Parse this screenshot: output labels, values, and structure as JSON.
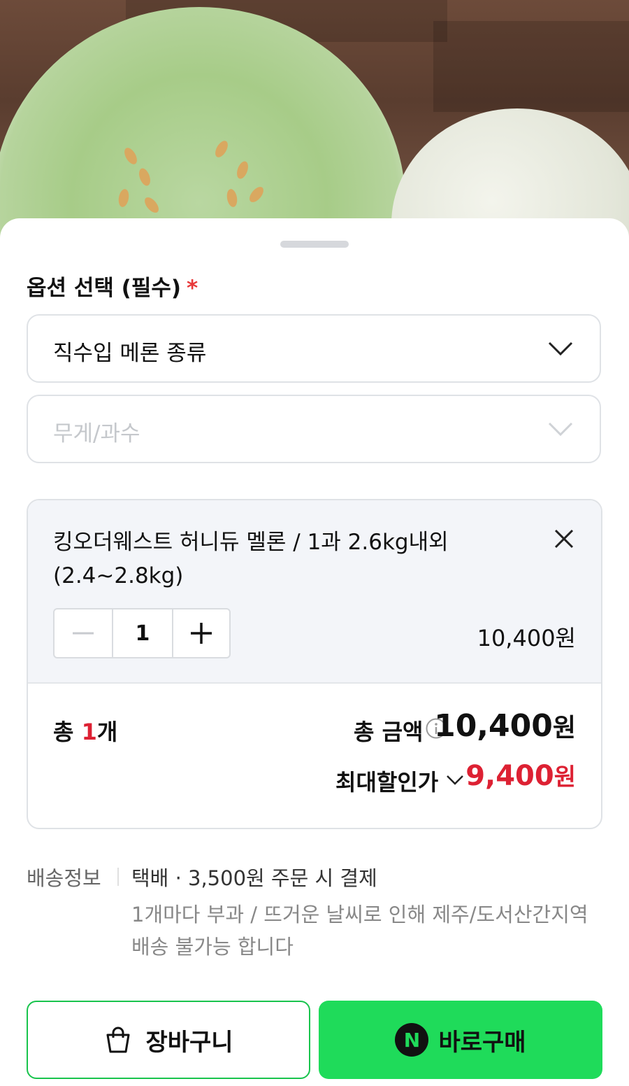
{
  "product_image": {
    "alt": ""
  },
  "option_section": {
    "title": "옵션 선택 (필수)",
    "required_mark": "*",
    "select1": {
      "value": "직수입 메론 종류",
      "icon": "chevron-down-icon"
    },
    "select2": {
      "placeholder": "무게/과수",
      "icon": "chevron-down-icon"
    }
  },
  "selected_option": {
    "name": "킹오더웨스트 허니듀 멜론 / 1과 2.6kg내외 (2.4~2.8kg)",
    "quantity": "1",
    "price": "10,400원"
  },
  "summary": {
    "total_count_prefix": "총 ",
    "total_count_value": "1",
    "total_count_suffix": "개",
    "total_amount_label": "총 금액",
    "total_amount_value": "10,400",
    "total_amount_unit": "원",
    "max_discount_label": "최대할인가",
    "max_discount_value": "9,400",
    "max_discount_unit": "원"
  },
  "shipping": {
    "label": "배송정보",
    "main": "택배 · 3,500원 주문 시 결제",
    "note": "1개마다 부과 / 뜨거운 날씨로 인해 제주/도서산간지역 배송 불가능 합니다"
  },
  "buttons": {
    "cart": "장바구니",
    "buy": "바로구매",
    "npay_letter": "N"
  },
  "colors": {
    "accent_green": "#1fdb5a",
    "price_red": "#dd2133"
  }
}
